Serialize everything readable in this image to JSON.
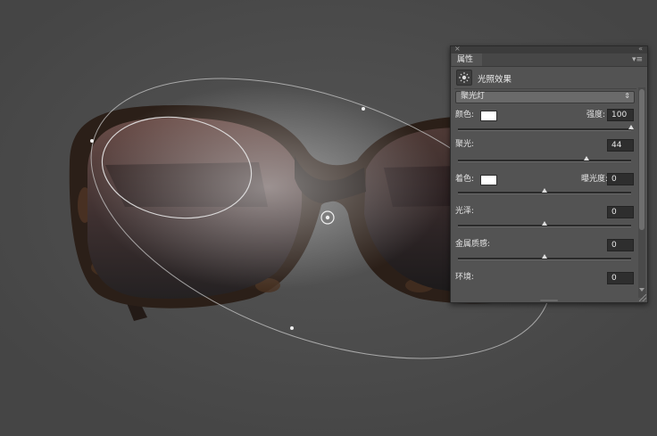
{
  "panel": {
    "close_glyph": "×",
    "collapse_glyph": "«",
    "tab_label": "属性",
    "menu_glyph": "▾≡",
    "header_icon": "lighting-effects-icon",
    "header_title": "光照效果",
    "preset": {
      "value": "聚光灯",
      "arrow": "⇕"
    },
    "color_label": "颜色:",
    "color_value": "#ffffff",
    "intensity_label": "强度:",
    "intensity_value": "100",
    "intensity_level": 1.0,
    "hotspot_label": "聚光:",
    "hotspot_value": "44",
    "hotspot_level": 0.74,
    "colorize_label": "着色:",
    "colorize_value": "#ffffff",
    "exposure_label": "曝光度:",
    "exposure_value": "0",
    "exposure_level": 0.5,
    "gloss_label": "光泽:",
    "gloss_value": "0",
    "gloss_level": 0.5,
    "metallic_label": "金属质感:",
    "metallic_value": "0",
    "metallic_level": 0.5,
    "ambience_label": "环境:",
    "ambience_value": "0"
  }
}
